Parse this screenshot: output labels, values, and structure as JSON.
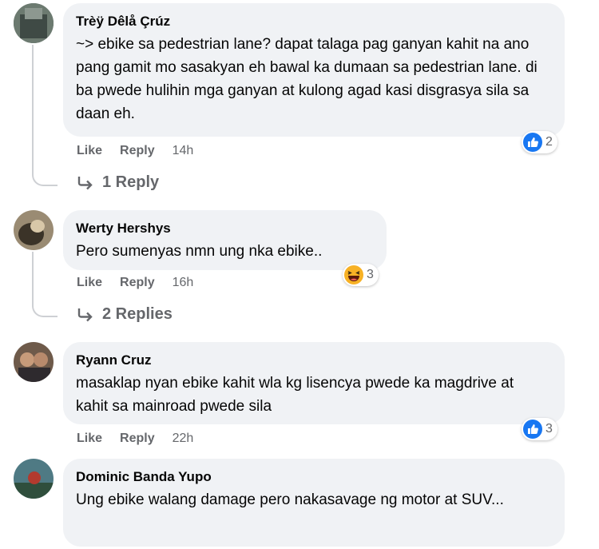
{
  "comments": [
    {
      "author": "Trèÿ Dêlå Çrúz",
      "text": "~> ebike sa pedestrian lane? dapat talaga pag ganyan kahit na ano pang gamit mo sasakyan eh bawal ka dumaan sa pedestrian lane. di ba pwede hulihin mga ganyan at kulong agad kasi disgrasya sila sa daan eh.",
      "like": "Like",
      "reply": "Reply",
      "time": "14h",
      "reaction_icon": "like-icon",
      "reaction_count": "2",
      "replies_label": "1 Reply"
    },
    {
      "author": "Werty Hershys",
      "text": "Pero sumenyas nmn ung nka ebike..",
      "like": "Like",
      "reply": "Reply",
      "time": "16h",
      "reaction_icon": "haha-icon",
      "reaction_count": "3",
      "replies_label": "2 Replies"
    },
    {
      "author": "Ryann Cruz",
      "text": "masaklap nyan ebike kahit wla kg lisencya pwede ka magdrive at kahit sa mainroad pwede sila",
      "like": "Like",
      "reply": "Reply",
      "time": "22h",
      "reaction_icon": "like-icon",
      "reaction_count": "3"
    },
    {
      "author": "Dominic Banda Yupo",
      "text": "Ung ebike walang damage pero nakasavage ng motor at SUV..."
    }
  ],
  "colors": {
    "bubble": "#f0f2f5",
    "secondary_text": "#65676b",
    "like_blue": "#1877f2",
    "haha_yellow": "#f7b125"
  }
}
